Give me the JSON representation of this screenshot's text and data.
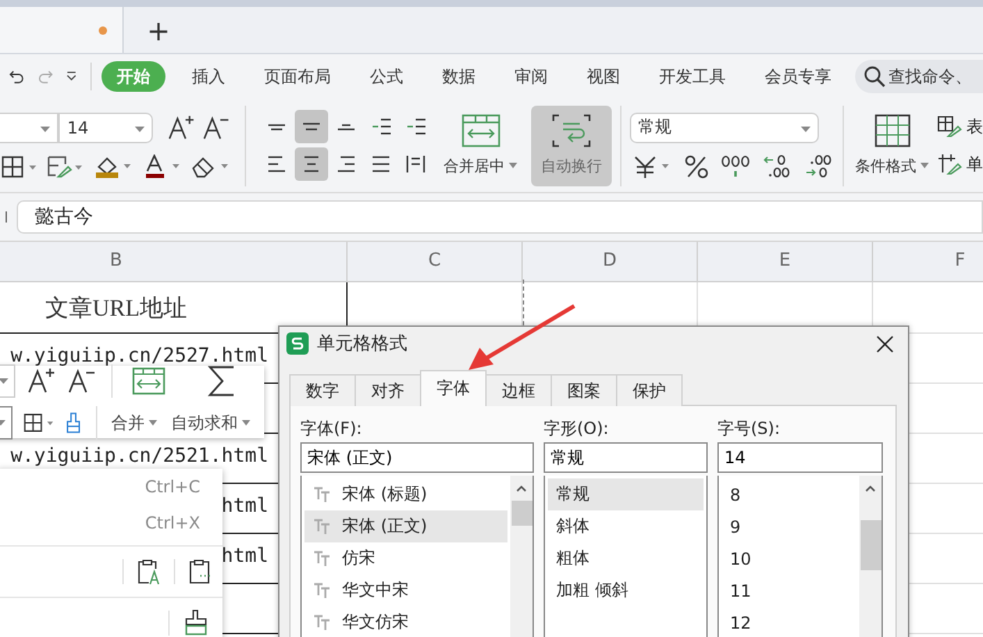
{
  "document_tab": {
    "unsaved": true,
    "new_tab": "+"
  },
  "ribbon_tabs": [
    {
      "label": "开始",
      "selected": true
    },
    {
      "label": "插入",
      "selected": false
    },
    {
      "label": "页面布局",
      "selected": false
    },
    {
      "label": "公式",
      "selected": false
    },
    {
      "label": "数据",
      "selected": false
    },
    {
      "label": "审阅",
      "selected": false
    },
    {
      "label": "视图",
      "selected": false
    },
    {
      "label": "开发工具",
      "selected": false
    },
    {
      "label": "会员专享",
      "selected": false
    }
  ],
  "search": {
    "placeholder": "查找命令、"
  },
  "font_size": "14",
  "alignment_buttons": [
    {
      "kind": "top",
      "selected": false
    },
    {
      "kind": "middle",
      "selected": true
    },
    {
      "kind": "bottom",
      "selected": false
    },
    {
      "kind": "outdent",
      "selected": false
    },
    {
      "kind": "indent",
      "selected": false
    },
    {
      "kind": "left",
      "selected": false
    },
    {
      "kind": "center",
      "selected": true
    },
    {
      "kind": "right",
      "selected": false
    },
    {
      "kind": "justify",
      "selected": false
    },
    {
      "kind": "distributed",
      "selected": false
    }
  ],
  "merge_button": {
    "label": "合并居中"
  },
  "wrap_button": {
    "label": "自动换行",
    "selected": true
  },
  "number_format": {
    "value": "常规"
  },
  "style_buttons": [
    {
      "kind": "conditional",
      "label": "条件格式"
    },
    {
      "kind": "table",
      "label": "表"
    },
    {
      "kind": "cell",
      "label": "单"
    }
  ],
  "formula_bar": {
    "value": "懿古今"
  },
  "columns": [
    "B",
    "C",
    "D",
    "E",
    "F"
  ],
  "rows": [
    {
      "kind": "title",
      "text": "文章URL地址"
    },
    {
      "kind": "url",
      "text": "w.yiguiip.cn/2527.html"
    },
    {
      "kind": "url"
    },
    {
      "kind": "url",
      "text": "w.yiguiip.cn/2521.html"
    },
    {
      "kind": "url",
      "text": "html"
    },
    {
      "kind": "url",
      "text": "html"
    },
    {
      "kind": "url"
    }
  ],
  "mini_toolbar": {
    "buttons": [
      {
        "label": "合并"
      },
      {
        "label": "自动求和"
      }
    ]
  },
  "context_menu": {
    "items": [
      {
        "shortcut": "Ctrl+C"
      },
      {
        "shortcut": "Ctrl+X"
      }
    ]
  },
  "dialog": {
    "title": "单元格格式",
    "tabs": [
      {
        "label": "数字",
        "selected": false
      },
      {
        "label": "对齐",
        "selected": false
      },
      {
        "label": "字体",
        "selected": true
      },
      {
        "label": "边框",
        "selected": false
      },
      {
        "label": "图案",
        "selected": false
      },
      {
        "label": "保护",
        "selected": false
      }
    ],
    "lists": [
      {
        "kind": "font",
        "label": "字体(F):",
        "value": "宋体 (正文)",
        "options": [
          {
            "label": "宋体 (标题)",
            "selected": false
          },
          {
            "label": "宋体 (正文)",
            "selected": true
          },
          {
            "label": "仿宋",
            "selected": false
          },
          {
            "label": "华文中宋",
            "selected": false
          },
          {
            "label": "华文仿宋",
            "selected": false
          }
        ]
      },
      {
        "kind": "style",
        "label": "字形(O):",
        "value": "常规",
        "options": [
          {
            "label": "常规",
            "selected": true
          },
          {
            "label": "斜体",
            "selected": false
          },
          {
            "label": "粗体",
            "selected": false
          },
          {
            "label": "加粗 倾斜",
            "selected": false
          }
        ]
      },
      {
        "kind": "size",
        "label": "字号(S):",
        "value": "14",
        "options": [
          {
            "label": "8",
            "selected": false
          },
          {
            "label": "9",
            "selected": false
          },
          {
            "label": "10",
            "selected": false
          },
          {
            "label": "11",
            "selected": false
          },
          {
            "label": "12",
            "selected": false
          }
        ]
      }
    ]
  }
}
